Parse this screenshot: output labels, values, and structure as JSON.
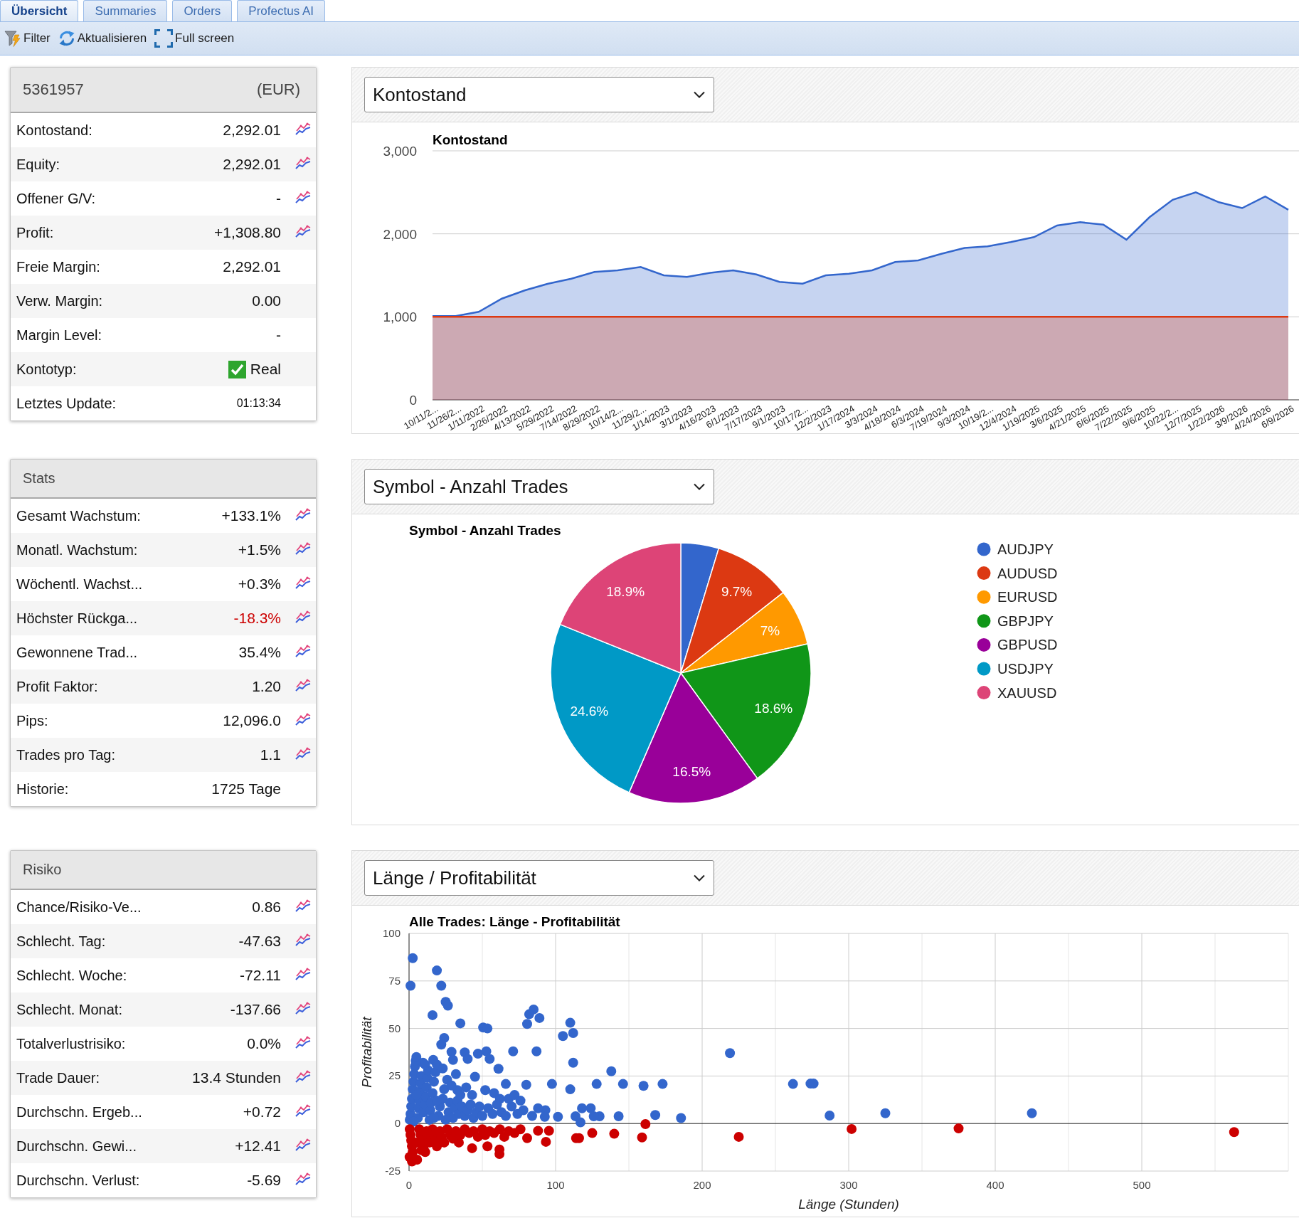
{
  "tabs": [
    {
      "label": "Übersicht",
      "selected": true
    },
    {
      "label": "Summaries",
      "selected": false
    },
    {
      "label": "Orders",
      "selected": false
    },
    {
      "label": "Profectus AI",
      "selected": false
    }
  ],
  "toolbar": [
    {
      "kind": "filter",
      "label": "Filter"
    },
    {
      "kind": "refresh",
      "label": "Aktualisieren"
    },
    {
      "kind": "fullscreen",
      "label": "Full screen"
    }
  ],
  "account": {
    "number": "5361957",
    "currency": "(EUR)",
    "rows": [
      {
        "kind": "value",
        "label": "Kontostand:",
        "value": "2,292.01",
        "chart_link": true
      },
      {
        "kind": "value",
        "label": "Equity:",
        "value": "2,292.01",
        "chart_link": true
      },
      {
        "kind": "value",
        "label": "Offener G/V:",
        "value": "-",
        "chart_link": true
      },
      {
        "kind": "value",
        "label": "Profit:",
        "value": "+1,308.80",
        "chart_link": true
      },
      {
        "kind": "value",
        "label": "Freie Margin:",
        "value": "2,292.01",
        "chart_link": false
      },
      {
        "kind": "value",
        "label": "Verw. Margin:",
        "value": "0.00",
        "chart_link": false
      },
      {
        "kind": "value",
        "label": "Margin Level:",
        "value": "-",
        "chart_link": false
      },
      {
        "kind": "check",
        "label": "Kontotyp:",
        "value": "Real",
        "checked": true,
        "chart_link": false
      },
      {
        "kind": "time",
        "label": "Letztes Update:",
        "value": "01:13:34",
        "chart_link": false
      }
    ]
  },
  "stats": {
    "title": "Stats",
    "rows": [
      {
        "label": "Gesamt Wachstum:",
        "value": "+133.1%",
        "alert": false,
        "chart_link": true
      },
      {
        "label": "Monatl. Wachstum:",
        "value": "+1.5%",
        "alert": false,
        "chart_link": true
      },
      {
        "label": "Wöchentl. Wachst...",
        "value": "+0.3%",
        "alert": false,
        "chart_link": true
      },
      {
        "label": "Höchster Rückga...",
        "value": "-18.3%",
        "alert": true,
        "chart_link": true
      },
      {
        "label": "Gewonnene Trad...",
        "value": "35.4%",
        "alert": false,
        "chart_link": true
      },
      {
        "label": "Profit Faktor:",
        "value": "1.20",
        "alert": false,
        "chart_link": true
      },
      {
        "label": "Pips:",
        "value": "12,096.0",
        "alert": false,
        "chart_link": true
      },
      {
        "label": "Trades pro Tag:",
        "value": "1.1",
        "alert": false,
        "chart_link": true
      },
      {
        "label": "Historie:",
        "value": "1725 Tage",
        "alert": false,
        "chart_link": false
      }
    ]
  },
  "risk": {
    "title": "Risiko",
    "rows": [
      {
        "label": "Chance/Risiko-Ve...",
        "value": "0.86",
        "chart_link": true
      },
      {
        "label": "Schlecht. Tag:",
        "value": "-47.63",
        "chart_link": true
      },
      {
        "label": "Schlecht. Woche:",
        "value": "-72.11",
        "chart_link": true
      },
      {
        "label": "Schlecht. Monat:",
        "value": "-137.66",
        "chart_link": true
      },
      {
        "label": "Totalverlustrisiko:",
        "value": "0.0%",
        "chart_link": true
      },
      {
        "label": "Trade Dauer:",
        "value": "13.4 Stunden",
        "chart_link": true
      },
      {
        "label": "Durchschn. Ergeb...",
        "value": "+0.72",
        "chart_link": true
      },
      {
        "label": "Durchschn. Gewi...",
        "value": "+12.41",
        "chart_link": true
      },
      {
        "label": "Durchschn. Verlust:",
        "value": "-5.69",
        "chart_link": true
      }
    ]
  },
  "balance_chart": {
    "selector": "Kontostand",
    "chart_data": {
      "type": "area",
      "title": "Kontostand",
      "categories": [
        "10/11/2...",
        "11/26/2...",
        "1/11/2022",
        "2/26/2022",
        "4/13/2022",
        "5/29/2022",
        "7/14/2022",
        "8/29/2022",
        "10/14/2...",
        "11/29/2...",
        "1/14/2023",
        "3/1/2023",
        "4/16/2023",
        "6/1/2023",
        "7/17/2023",
        "9/1/2023",
        "10/17/2...",
        "12/2/2023",
        "1/17/2024",
        "3/3/2024",
        "4/18/2024",
        "6/3/2024",
        "7/19/2024",
        "9/3/2024",
        "10/19/2...",
        "12/4/2024",
        "1/19/2025",
        "3/6/2025",
        "4/21/2025",
        "6/6/2025",
        "7/22/2025",
        "9/6/2025",
        "10/22/2...",
        "12/7/2025",
        "1/22/2026",
        "3/9/2026",
        "4/24/2026",
        "6/9/2026"
      ],
      "ylim": [
        0,
        3000
      ],
      "yticks": [
        {
          "value": 0,
          "label": "0"
        },
        {
          "value": 1000,
          "label": "1,000"
        },
        {
          "value": 2000,
          "label": "2,000"
        },
        {
          "value": 3000,
          "label": "3,000"
        }
      ],
      "grid": true,
      "series": [
        {
          "color": "#3366cc",
          "values": [
            1010,
            1010,
            1060,
            1220,
            1320,
            1400,
            1460,
            1540,
            1560,
            1600,
            1500,
            1480,
            1530,
            1560,
            1510,
            1420,
            1400,
            1500,
            1520,
            1560,
            1660,
            1680,
            1760,
            1830,
            1850,
            1900,
            1960,
            2100,
            2140,
            2110,
            1930,
            2200,
            2410,
            2500,
            2380,
            2310,
            2450,
            2290
          ]
        },
        {
          "color": "#dc3912",
          "values": [
            1000,
            1000,
            1000,
            1000,
            1000,
            1000,
            1000,
            1000,
            1000,
            1000,
            1000,
            1000,
            1000,
            1000,
            1000,
            1000,
            1000,
            1000,
            1000,
            1000,
            1000,
            1000,
            1000,
            1000,
            1000,
            1000,
            1000,
            1000,
            1000,
            1000,
            1000,
            1000,
            1000,
            1000,
            1000,
            1000,
            1000,
            1000
          ]
        }
      ]
    }
  },
  "symbol_chart": {
    "selector": "Symbol - Anzahl Trades",
    "chart_data": {
      "type": "pie",
      "title": "Symbol - Anzahl Trades",
      "categories": [
        "AUDJPY",
        "AUDUSD",
        "EURUSD",
        "GBPJPY",
        "GBPUSD",
        "USDJPY",
        "XAUUSD"
      ],
      "values": [
        4.7,
        9.7,
        7,
        18.6,
        16.5,
        24.6,
        18.9
      ],
      "colors": [
        "#3366cc",
        "#dc3912",
        "#ff9900",
        "#109618",
        "#990099",
        "#0099c6",
        "#dd4477"
      ],
      "value_labels": [
        null,
        "9.7%",
        "7%",
        "18.6%",
        "16.5%",
        "24.6%",
        "18.9%"
      ],
      "legend": "right"
    }
  },
  "duration_chart": {
    "selector": "Länge / Profitabilität",
    "chart_data": {
      "type": "scatter",
      "title": "Alle Trades: Länge - Profitabilität",
      "xlabel": "Länge (Stunden)",
      "ylabel": "Profitabilität",
      "xlim": [
        0,
        600
      ],
      "ylim": [
        -25,
        100
      ],
      "xticks": [
        0,
        100,
        200,
        300,
        400,
        500
      ],
      "yticks": [
        -25,
        0,
        25,
        50,
        75,
        100
      ],
      "grid": true,
      "series": [
        {
          "color": "#3366cc",
          "x": [
            2.5,
            1,
            19,
            22,
            16,
            25,
            26.5,
            35,
            24,
            50.6,
            53.5,
            82,
            85,
            89,
            80.6,
            105,
            110,
            112,
            87,
            112,
            219,
            262,
            274,
            276,
            287,
            325,
            425,
            173,
            160,
            146,
            138,
            128,
            168,
            185.6,
            143,
            130,
            126,
            124,
            118,
            117,
            113.6,
            101.6,
            97.5,
            110,
            93,
            92.6,
            61,
            66,
            80,
            71,
            52.7,
            47,
            38,
            40,
            55,
            33,
            45,
            52,
            30,
            29,
            22,
            16.5,
            0.5,
            1,
            1.5,
            2,
            2.5,
            3,
            3.5,
            4,
            4.5,
            5,
            6,
            6.5,
            7,
            7.5,
            8,
            8.5,
            9.5,
            10,
            11,
            11.5,
            12,
            12.5,
            13,
            14,
            14.5,
            15,
            16,
            17,
            18,
            19,
            20,
            21,
            23,
            24,
            26,
            27,
            28,
            30,
            31,
            33,
            34,
            36,
            38,
            40,
            42,
            44,
            46,
            48,
            50,
            54,
            57,
            60,
            63,
            66,
            70,
            74,
            78,
            84,
            88,
            3,
            5,
            11,
            17,
            19,
            23,
            25,
            29,
            32,
            35,
            39,
            43,
            58,
            62,
            68,
            72,
            76
          ],
          "values": [
            87,
            72.5,
            80.5,
            72.5,
            57,
            64,
            62,
            52.7,
            45,
            50.5,
            50,
            57.5,
            60,
            55.5,
            52.4,
            46,
            53,
            47.6,
            38,
            32,
            37,
            20.8,
            21,
            21,
            4.2,
            5.4,
            5.4,
            20.8,
            19.8,
            20.8,
            27.5,
            20.8,
            4.5,
            2.9,
            3.8,
            3.8,
            3.8,
            8,
            8,
            0.6,
            3.8,
            3.5,
            20.8,
            18,
            7,
            3.5,
            28.8,
            20.8,
            20.4,
            38,
            38,
            36.7,
            37.4,
            34,
            34,
            17.6,
            24.6,
            17.6,
            33.5,
            37.7,
            41.5,
            33.5,
            2,
            5,
            9,
            13,
            18,
            22,
            26,
            30,
            33,
            35,
            3,
            8,
            12,
            17,
            21,
            25,
            32,
            6,
            10,
            14,
            19,
            24,
            28,
            2,
            7,
            11,
            16,
            22,
            27,
            31,
            4,
            9,
            13,
            18,
            23,
            6,
            11,
            3,
            8,
            12,
            5,
            9,
            4,
            7,
            10,
            3,
            6,
            9,
            4,
            8,
            5,
            10,
            6,
            4,
            9,
            5,
            7,
            4,
            8,
            1,
            15,
            31,
            3,
            12,
            29,
            2,
            20,
            26,
            15,
            19,
            15,
            16,
            13,
            13,
            15,
            12
          ]
        },
        {
          "color": "#cc0000",
          "x": [
            161.3,
            159,
            225,
            302,
            375,
            563,
            140,
            125,
            116,
            114,
            93.4,
            95.5,
            88,
            80.6,
            61.7,
            61.7,
            53.5,
            43,
            34,
            2,
            0.4,
            0.5,
            1,
            1.5,
            2,
            2.5,
            5,
            7,
            8,
            9,
            10,
            11,
            12,
            13,
            14,
            16,
            17,
            18,
            19,
            21,
            22,
            24,
            26,
            28,
            30,
            32,
            35,
            38,
            41,
            44,
            47,
            50,
            52,
            55,
            58,
            62,
            65,
            68,
            72,
            76,
            5.5,
            8.5
          ],
          "values": [
            -0.3,
            -7.3,
            -7,
            -2.9,
            -2.6,
            -4.5,
            -5.4,
            -5,
            -7.7,
            -7.7,
            -9.6,
            -3.8,
            -3.8,
            -7.7,
            -16,
            -13.7,
            -12,
            -13,
            -10,
            -20,
            -17.6,
            -3,
            -6,
            -9,
            -12,
            -15,
            -10,
            -3,
            -6,
            -9,
            -12,
            -15,
            -4,
            -7,
            -10,
            -3,
            -6,
            -9,
            -12,
            -4,
            -7,
            -10,
            -3,
            -6,
            -8,
            -4,
            -6,
            -3,
            -5,
            -4,
            -7,
            -3,
            -6,
            -4,
            -5,
            -3,
            -7,
            -4,
            -5,
            -3,
            -19,
            -14
          ]
        }
      ]
    }
  }
}
